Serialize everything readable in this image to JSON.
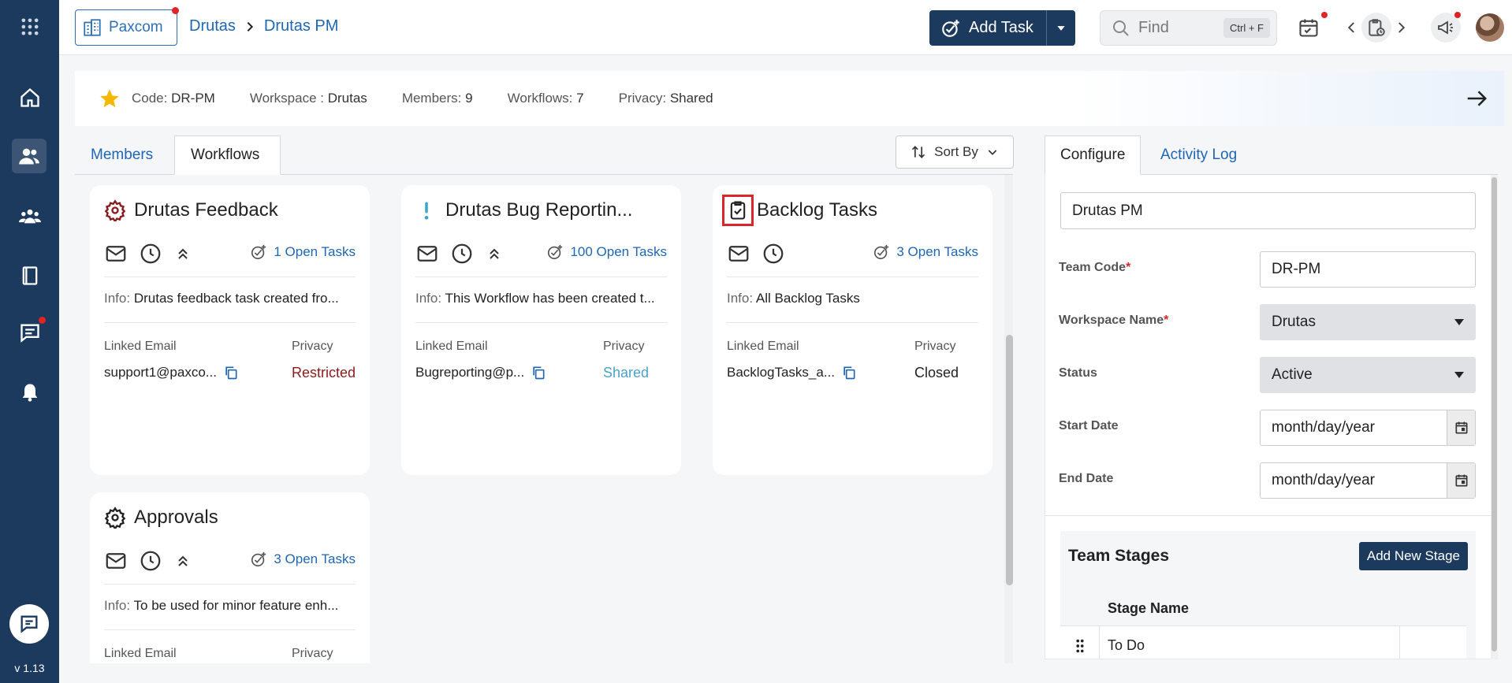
{
  "sidebar": {
    "version": "v 1.13",
    "items": [
      {
        "name": "apps-grid-icon"
      },
      {
        "name": "home-icon"
      },
      {
        "name": "teams-icon",
        "active": true
      },
      {
        "name": "groups-icon"
      },
      {
        "name": "book-icon"
      },
      {
        "name": "messages-icon",
        "badge": true
      },
      {
        "name": "alerts-icon"
      }
    ]
  },
  "header": {
    "org_label": "Paxcom",
    "breadcrumb": [
      "Drutas",
      "Drutas PM"
    ],
    "add_task_label": "Add Task",
    "find_placeholder": "Find",
    "find_shortcut": "Ctrl + F"
  },
  "infobar": {
    "code_label": "Code:",
    "code_value": "DR-PM",
    "workspace_label": "Workspace :",
    "workspace_value": "Drutas",
    "members_label": "Members:",
    "members_value": "9",
    "workflows_label": "Workflows:",
    "workflows_value": "7",
    "privacy_label": "Privacy:",
    "privacy_value": "Shared"
  },
  "left_tabs": {
    "members": "Members",
    "workflows": "Workflows",
    "sort_by": "Sort By"
  },
  "workflows": [
    {
      "title": "Drutas Feedback",
      "icon": "gear-icon",
      "icon_color": "#8b1a1a",
      "open_tasks": "1 Open Tasks",
      "info_label": "Info:",
      "info": "Drutas feedback task created fro...",
      "linked_email_label": "Linked Email",
      "linked_email": "support1@paxco...",
      "privacy_label": "Privacy",
      "privacy": "Restricted",
      "privacy_color": "#8b1a1a"
    },
    {
      "title": "Drutas Bug Reportin...",
      "icon": "exclamation-icon",
      "icon_color": "#3aa6c9",
      "open_tasks": "100 Open Tasks",
      "info_label": "Info:",
      "info": "This Workflow has been created t...",
      "linked_email_label": "Linked Email",
      "linked_email": "Bugreporting@p...",
      "privacy_label": "Privacy",
      "privacy": "Shared",
      "privacy_color": "#4aa3c7"
    },
    {
      "title": "Backlog Tasks",
      "icon": "clipboard-check-icon",
      "icon_color": "#222222",
      "open_tasks": "3 Open Tasks",
      "info_label": "Info:",
      "info": "All Backlog Tasks",
      "linked_email_label": "Linked Email",
      "linked_email": "BacklogTasks_a...",
      "privacy_label": "Privacy",
      "privacy": "Closed",
      "privacy_color": "#222222"
    },
    {
      "title": "Approvals",
      "icon": "gear-icon",
      "icon_color": "#222222",
      "open_tasks": "3 Open Tasks",
      "info_label": "Info:",
      "info": "To be used for minor feature enh...",
      "linked_email_label": "Linked Email",
      "privacy_label": "Privacy"
    }
  ],
  "right_tabs": {
    "configure": "Configure",
    "activity_log": "Activity Log"
  },
  "configure": {
    "team_name": "Drutas PM",
    "team_code_label": "Team Code",
    "team_code": "DR-PM",
    "workspace_label": "Workspace Name",
    "workspace": "Drutas",
    "status_label": "Status",
    "status": "Active",
    "start_date_label": "Start Date",
    "start_date": "month/day/year",
    "end_date_label": "End Date",
    "end_date": "month/day/year",
    "stages_title": "Team Stages",
    "add_stage_label": "Add New Stage",
    "stage_name_header": "Stage Name",
    "stages": [
      "To Do"
    ]
  },
  "colors": {
    "sidebar": "#1c3a5e",
    "link": "#1f66b3",
    "highlight": "#d9262c"
  }
}
